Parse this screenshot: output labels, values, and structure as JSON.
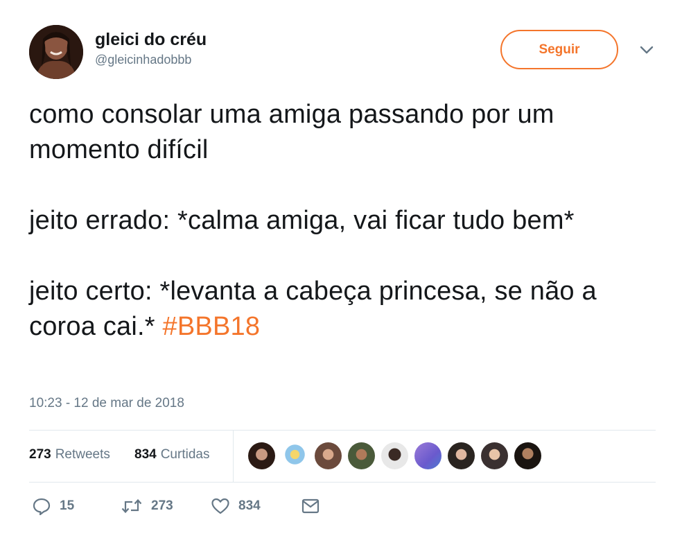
{
  "user": {
    "display_name": "gleici do créu",
    "handle": "@gleicinhadobbb"
  },
  "follow_button_label": "Seguir",
  "tweet": {
    "paragraphs": [
      "como consolar uma amiga passando por um momento difícil",
      "jeito errado: *calma amiga, vai ficar tudo bem*",
      "jeito certo: *levanta a cabeça princesa, se não a coroa cai.*"
    ],
    "hashtag": "#BBB18",
    "timestamp": "10:23 - 12 de mar de 2018"
  },
  "stats": {
    "retweets_count": "273",
    "retweets_label": "Retweets",
    "likes_count": "834",
    "likes_label": "Curtidas"
  },
  "actions": {
    "reply_count": "15",
    "retweet_count": "273",
    "like_count": "834"
  },
  "colors": {
    "accent": "#f4752b",
    "text": "#14171a",
    "secondary": "#657786",
    "divider": "#e1e8ed"
  },
  "icons": [
    "caret-down-icon",
    "reply-icon",
    "retweet-icon",
    "heart-icon",
    "direct-message-icon"
  ]
}
